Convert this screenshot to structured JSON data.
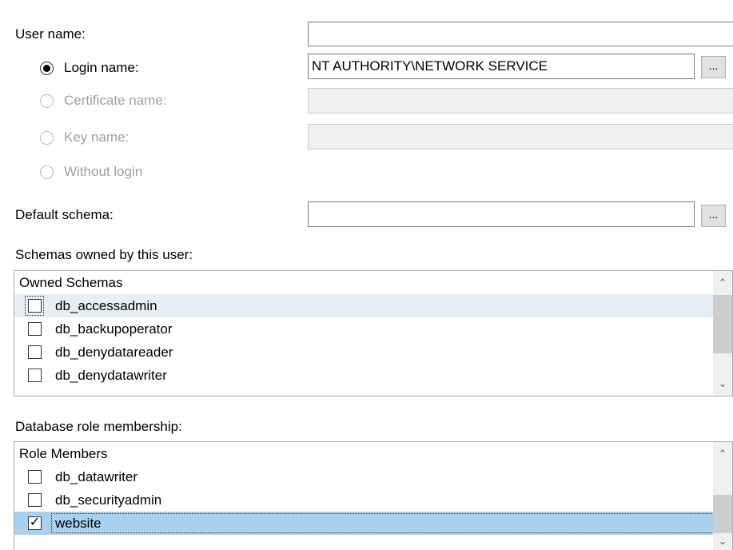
{
  "user_name": {
    "label": "User name:",
    "value": ""
  },
  "login_type": {
    "options": [
      {
        "label": "Login name:",
        "selected": true,
        "enabled": true
      },
      {
        "label": "Certificate name:",
        "selected": false,
        "enabled": false
      },
      {
        "label": "Key name:",
        "selected": false,
        "enabled": false
      },
      {
        "label": "Without login",
        "selected": false,
        "enabled": false
      }
    ]
  },
  "login_name_value": "NT AUTHORITY\\NETWORK SERVICE",
  "certificate_name_value": "",
  "key_name_value": "",
  "browse_label": "...",
  "default_schema": {
    "label": "Default schema:",
    "value": ""
  },
  "schemas_owned": {
    "label": "Schemas owned by this user:",
    "header": "Owned Schemas",
    "rows": [
      {
        "name": "db_accessadmin",
        "checked": false
      },
      {
        "name": "db_backupoperator",
        "checked": false
      },
      {
        "name": "db_denydatareader",
        "checked": false
      },
      {
        "name": "db_denydatawriter",
        "checked": false
      }
    ]
  },
  "role_membership": {
    "label": "Database role membership:",
    "header": "Role Members",
    "rows": [
      {
        "name": "db_datawriter",
        "checked": false
      },
      {
        "name": "db_securityadmin",
        "checked": false
      },
      {
        "name": "website",
        "checked": true
      }
    ]
  },
  "icons": {
    "scroll_up": "chevron-up-icon",
    "scroll_down": "chevron-down-icon",
    "check": "checkmark-icon"
  }
}
